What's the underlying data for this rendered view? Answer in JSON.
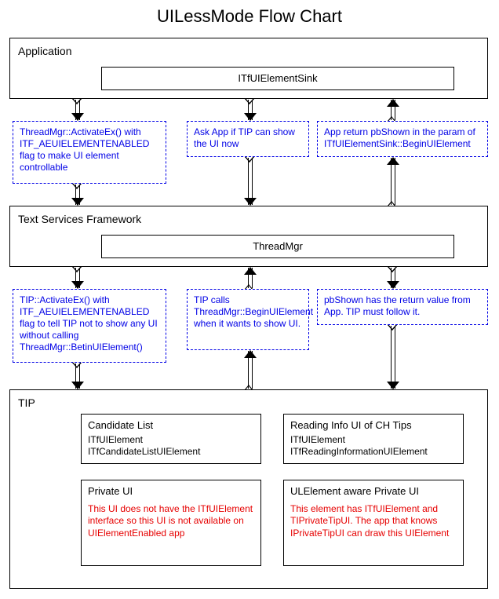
{
  "chart_data": {
    "type": "flowchart",
    "title": "UILessMode Flow Chart",
    "nodes": [
      {
        "id": "application",
        "type": "solid-container",
        "label": "Application",
        "children": [
          "itfuielementsink"
        ]
      },
      {
        "id": "itfuielementsink",
        "type": "solid-box",
        "label": "ITfUIElementSink"
      },
      {
        "id": "note1",
        "type": "dashed-note",
        "text": "ThreadMgr::ActivateEx() with ITF_AEUIELEMENTENABLED flag to make UI element controllable"
      },
      {
        "id": "note2",
        "type": "dashed-note",
        "text": "Ask App if TIP can show the UI now"
      },
      {
        "id": "note3",
        "type": "dashed-note",
        "text": "App return pbShown in the param of ITfUIElementSink::BeginUIElement"
      },
      {
        "id": "tsf",
        "type": "solid-container",
        "label": "Text Services Framework",
        "children": [
          "threadmgr"
        ]
      },
      {
        "id": "threadmgr",
        "type": "solid-box",
        "label": "ThreadMgr"
      },
      {
        "id": "note4",
        "type": "dashed-note",
        "text": "TIP::ActivateEx() with ITF_AEUIELEMENTENABLED flag to tell TIP not to show any UI without calling ThreadMgr::BetinUIElement()"
      },
      {
        "id": "note5",
        "type": "dashed-note",
        "text": "TIP calls ThreadMgr::BeginUIElement when it wants to show UI."
      },
      {
        "id": "note6",
        "type": "dashed-note",
        "text": "pbShown has the return value from App. TIP must follow it."
      },
      {
        "id": "tip",
        "type": "solid-container",
        "label": "TIP",
        "children": [
          "candidate_list",
          "reading_info",
          "private_ui",
          "ulelement_private"
        ]
      },
      {
        "id": "candidate_list",
        "type": "solid-box",
        "title": "Candidate List",
        "lines": [
          "ITfUIElement",
          "ITfCandidateListUIElement"
        ]
      },
      {
        "id": "reading_info",
        "type": "solid-box",
        "title": "Reading Info UI of CH Tips",
        "lines": [
          "ITfUIElement",
          "ITfReadingInformationUIElement"
        ]
      },
      {
        "id": "private_ui",
        "type": "solid-box",
        "title": "Private UI",
        "note": "This UI does not have the ITfUIElement interface so this UI is not available on UIElementEnabled app"
      },
      {
        "id": "ulelement_private",
        "type": "solid-box",
        "title": "ULElement aware Private UI",
        "note": "This element has ITfUIElement and TIPrivateTipUI. The app that knows IPrivateTipUI can draw this UIElement"
      }
    ],
    "arrows": [
      {
        "from": "application",
        "to": "note1",
        "direction": "down"
      },
      {
        "from": "itfuielementsink",
        "to": "note2",
        "direction": "down"
      },
      {
        "from": "note3",
        "to": "itfuielementsink",
        "direction": "up"
      },
      {
        "from": "note1",
        "to": "tsf",
        "direction": "down"
      },
      {
        "from": "note2",
        "to": "threadmgr",
        "direction": "down"
      },
      {
        "from": "threadmgr",
        "to": "note3",
        "direction": "up"
      },
      {
        "from": "threadmgr",
        "to": "note4",
        "direction": "down"
      },
      {
        "from": "note5",
        "to": "threadmgr",
        "direction": "up"
      },
      {
        "from": "threadmgr",
        "to": "note6",
        "direction": "down"
      },
      {
        "from": "note4",
        "to": "tip",
        "direction": "down"
      },
      {
        "from": "tip",
        "to": "note5",
        "direction": "up"
      },
      {
        "from": "note6",
        "to": "tip",
        "direction": "down"
      }
    ]
  },
  "title": "UILessMode Flow Chart",
  "application": {
    "label": "Application",
    "sink_label": "ITfUIElementSink"
  },
  "notes_top": {
    "note1": "ThreadMgr::ActivateEx() with ITF_AEUIELEMENTENABLED flag to make UI element controllable",
    "note2": "Ask App if TIP can show the UI now",
    "note3": "App return pbShown in the param of ITfUIElementSink::BeginUIElement"
  },
  "tsf": {
    "label": "Text Services Framework",
    "threadmgr_label": "ThreadMgr"
  },
  "notes_mid": {
    "note4": "TIP::ActivateEx() with ITF_AEUIELEMENTENABLED flag to tell TIP not to show any UI without calling ThreadMgr::BetinUIElement()",
    "note5": "TIP calls ThreadMgr::BeginUIElement when it wants to show UI.",
    "note6": "pbShown has the return value from App. TIP must follow it."
  },
  "tip": {
    "label": "TIP",
    "candidate_list": {
      "title": "Candidate List",
      "line1": "ITfUIElement",
      "line2": "ITfCandidateListUIElement"
    },
    "reading_info": {
      "title": "Reading Info UI of CH Tips",
      "line1": "ITfUIElement",
      "line2": "ITfReadingInformationUIElement"
    },
    "private_ui": {
      "title": "Private UI",
      "note": "This UI does not have the ITfUIElement interface so this UI is not available on UIElementEnabled app"
    },
    "ulelement_private": {
      "title": "ULElement aware Private UI",
      "note": "This element has ITfUIElement and TIPrivateTipUI. The app that knows IPrivateTipUI can draw this UIElement"
    }
  }
}
